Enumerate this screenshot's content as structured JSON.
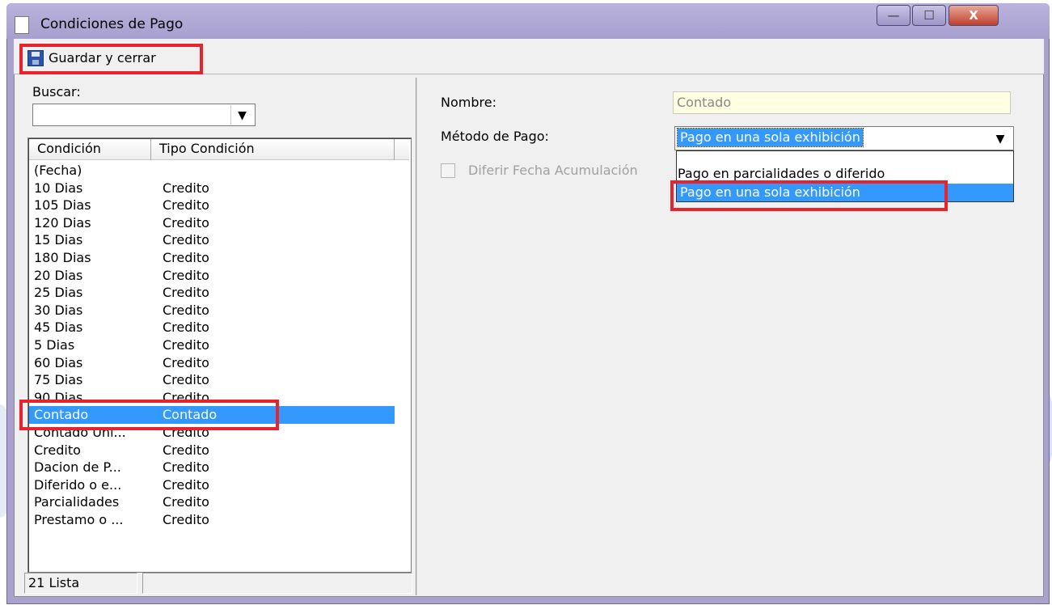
{
  "window": {
    "title": "Condiciones de Pago",
    "caption_buttons": {
      "minimize": "—",
      "maximize": "☐",
      "close": "X"
    }
  },
  "toolbar": {
    "save_label": "Guardar y cerrar"
  },
  "left_panel": {
    "search_label": "Buscar:",
    "search_value": "",
    "columns": [
      "Condición",
      "Tipo Condición"
    ],
    "rows": [
      {
        "condicion": "(Fecha)",
        "tipo": ""
      },
      {
        "condicion": "10 Dias",
        "tipo": "Credito"
      },
      {
        "condicion": "105 Dias",
        "tipo": "Credito"
      },
      {
        "condicion": "120 Dias",
        "tipo": "Credito"
      },
      {
        "condicion": "15 Dias",
        "tipo": "Credito"
      },
      {
        "condicion": "180 Dias",
        "tipo": "Credito"
      },
      {
        "condicion": "20 Dias",
        "tipo": "Credito"
      },
      {
        "condicion": "25 Dias",
        "tipo": "Credito"
      },
      {
        "condicion": "30 Dias",
        "tipo": "Credito"
      },
      {
        "condicion": "45 Dias",
        "tipo": "Credito"
      },
      {
        "condicion": "5 Dias",
        "tipo": "Credito"
      },
      {
        "condicion": "60 Dias",
        "tipo": "Credito"
      },
      {
        "condicion": "75 Dias",
        "tipo": "Credito"
      },
      {
        "condicion": "90 Dias",
        "tipo": "Credito"
      },
      {
        "condicion": "Contado",
        "tipo": "Contado",
        "selected": true
      },
      {
        "condicion": "Contado Uni...",
        "tipo": "Credito"
      },
      {
        "condicion": "Credito",
        "tipo": "Credito"
      },
      {
        "condicion": "Dacion de P...",
        "tipo": "Credito"
      },
      {
        "condicion": "Diferido o e...",
        "tipo": "Credito"
      },
      {
        "condicion": "Parcialidades",
        "tipo": "Credito"
      },
      {
        "condicion": "Prestamo o ...",
        "tipo": "Credito"
      }
    ],
    "status_count": "21 Lista"
  },
  "right_panel": {
    "nombre_label": "Nombre:",
    "nombre_value": "Contado",
    "metodo_label": "Método de Pago:",
    "metodo_value": "Pago en una sola exhibición",
    "metodo_options": [
      "Pago en parcialidades o diferido",
      "Pago en una sola exhibición"
    ],
    "diferir_label": "Diferir Fecha Acumulación",
    "diferir_checked": false
  },
  "colors": {
    "selection": "#3399ff",
    "highlight_box": "#e8232e",
    "readonly_field": "#ffffe1",
    "title_bar": "#aaa1cf"
  },
  "icons": {
    "title": "document-icon",
    "save": "floppy-disk-icon",
    "dropdown": "chevron-down-icon"
  }
}
